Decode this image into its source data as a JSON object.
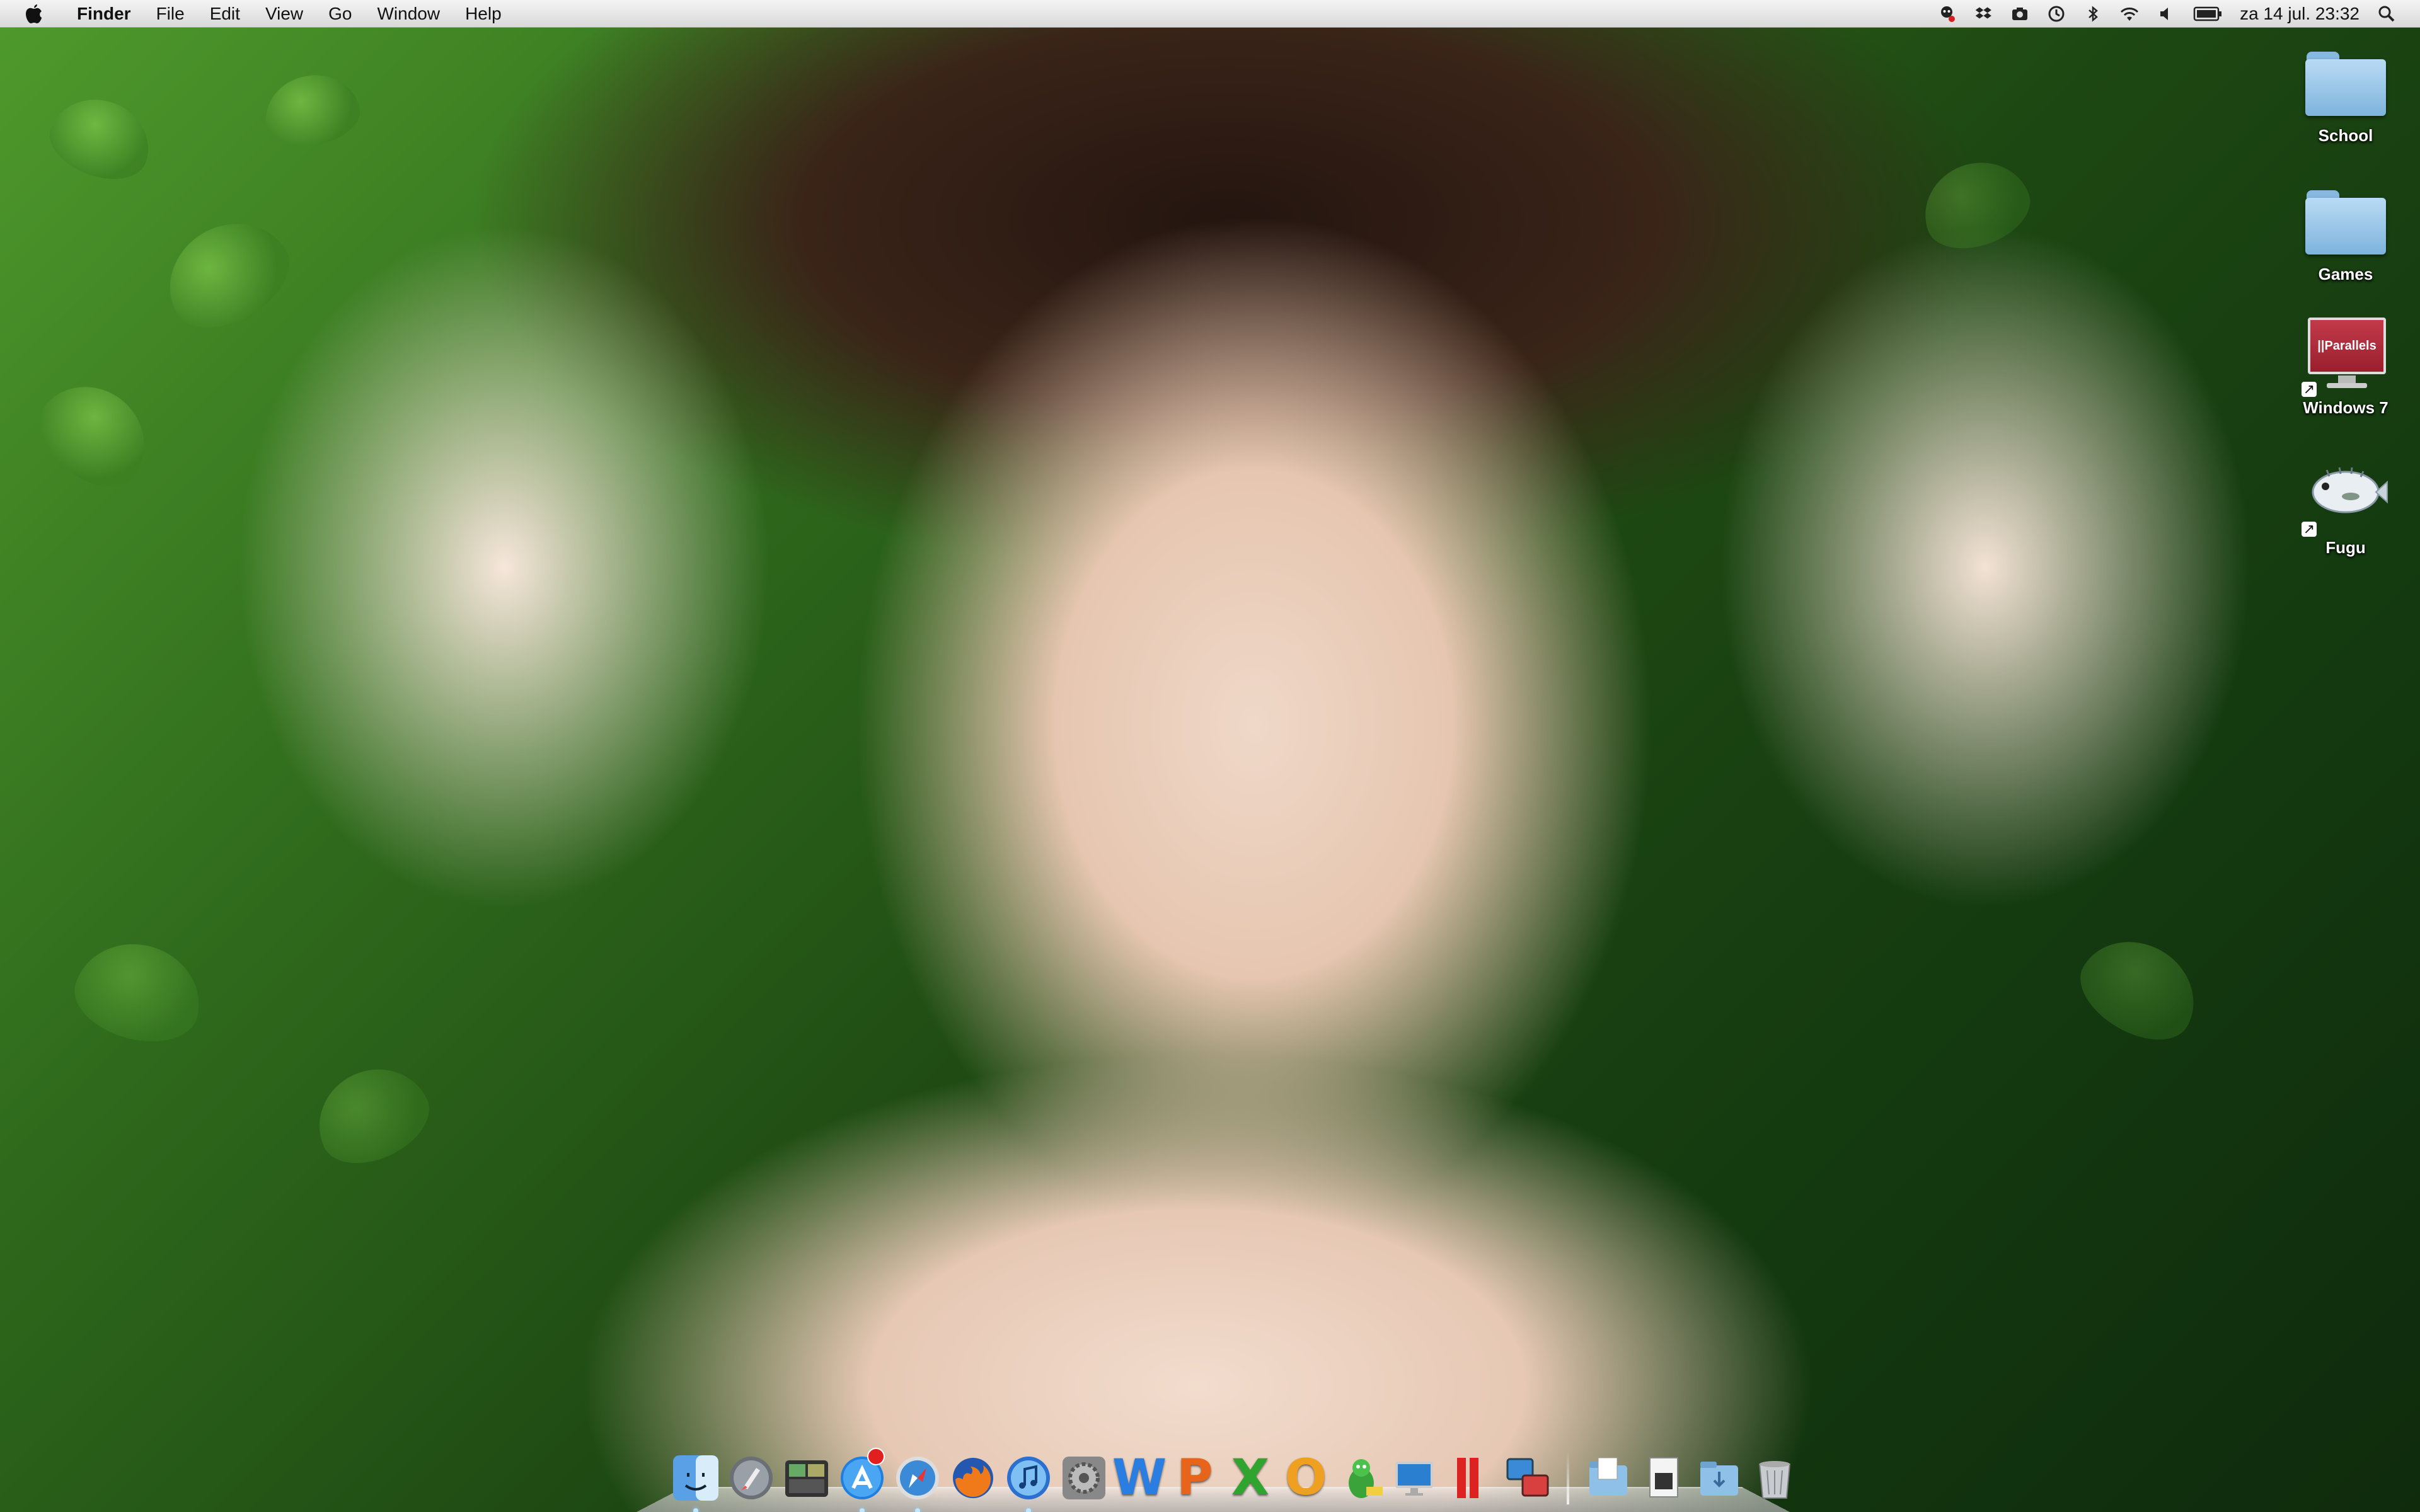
{
  "menubar": {
    "apple_icon": "apple-icon",
    "app_name": "Finder",
    "menus": [
      "File",
      "Edit",
      "View",
      "Go",
      "Window",
      "Help"
    ],
    "status_icons": [
      "user-agent-icon",
      "dropbox-icon",
      "camera-icon",
      "time-machine-icon",
      "bluetooth-icon",
      "wifi-icon",
      "volume-icon",
      "battery-icon"
    ],
    "clock": "za 14 jul.  23:32",
    "spotlight_icon": "spotlight-search-icon"
  },
  "desktop": {
    "icons": [
      {
        "label": "School",
        "kind": "folder"
      },
      {
        "label": "Games",
        "kind": "folder"
      },
      {
        "label": "Windows 7",
        "kind": "parallels-vm",
        "badge_text": "||Parallels"
      },
      {
        "label": "Fugu",
        "kind": "app-alias"
      }
    ]
  },
  "dock": {
    "apps": [
      {
        "name": "finder-icon",
        "running": true
      },
      {
        "name": "launchpad-icon",
        "running": false
      },
      {
        "name": "dashboard-icon",
        "running": false
      },
      {
        "name": "app-store-icon",
        "running": true,
        "badge": true
      },
      {
        "name": "safari-icon",
        "running": true
      },
      {
        "name": "firefox-icon",
        "running": false
      },
      {
        "name": "itunes-icon",
        "running": true
      },
      {
        "name": "system-preferences-icon",
        "running": false
      },
      {
        "name": "word-icon",
        "running": false
      },
      {
        "name": "powerpoint-icon",
        "running": false
      },
      {
        "name": "excel-icon",
        "running": false
      },
      {
        "name": "outlook-icon",
        "running": false
      },
      {
        "name": "adium-icon",
        "running": false
      },
      {
        "name": "remote-desktop-icon",
        "running": false
      },
      {
        "name": "parallels-icon",
        "running": false
      },
      {
        "name": "vm-switch-icon",
        "running": false
      }
    ],
    "stacks": [
      "documents-stack-icon",
      "file-stack-icon",
      "downloads-stack-icon",
      "trash-icon"
    ],
    "colors": {
      "word": "#2a7de1",
      "powerpoint": "#e8641b",
      "excel": "#2fa52f",
      "outlook": "#f0a020"
    },
    "letters": {
      "word": "W",
      "powerpoint": "P",
      "excel": "X",
      "outlook": "O"
    }
  }
}
